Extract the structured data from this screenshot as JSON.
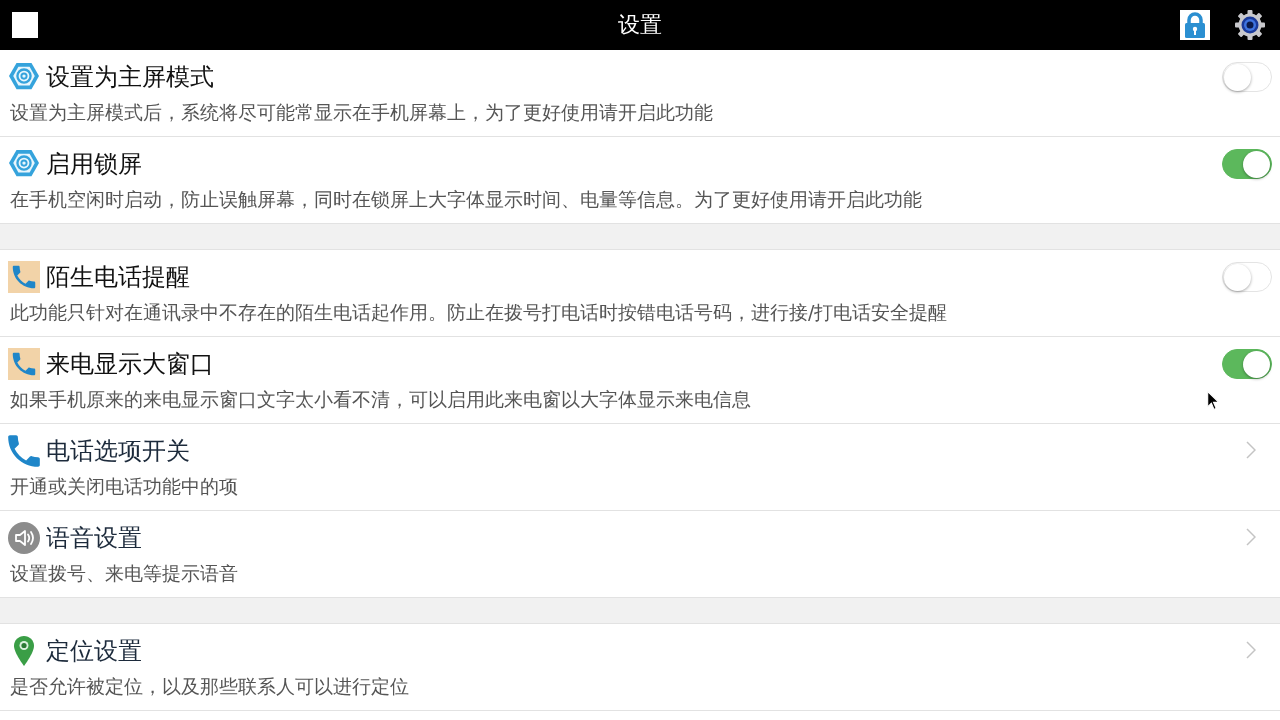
{
  "title_bar": {
    "title": "设置"
  },
  "sections": [
    {
      "items": [
        {
          "kind": "gear",
          "title": "设置为主屏模式",
          "description": "设置为主屏模式后，系统将尽可能常显示在手机屏幕上，为了更好使用请开启此功能",
          "control": {
            "kind": "switch",
            "on": false
          }
        },
        {
          "kind": "gear",
          "title": "启用锁屏",
          "description": "在手机空闲时启动，防止误触屏幕，同时在锁屏上大字体显示时间、电量等信息。为了更好使用请开启此功能",
          "control": {
            "kind": "switch",
            "on": true
          }
        }
      ]
    },
    {
      "items": [
        {
          "kind": "call",
          "title": "陌生电话提醒",
          "description": "此功能只针对在通讯录中不存在的陌生电话起作用。防止在拨号打电话时按错电话号码，进行接/打电话安全提醒",
          "control": {
            "kind": "switch",
            "on": false
          }
        },
        {
          "kind": "call",
          "title": "来电显示大窗口",
          "description": "如果手机原来的来电显示窗口文字太小看不清，可以启用此来电窗以大字体显示来电信息",
          "control": {
            "kind": "switch",
            "on": true
          }
        },
        {
          "kind": "phone",
          "title": "电话选项开关",
          "description": "开通或关闭电话功能中的项",
          "control": {
            "kind": "chevron"
          }
        },
        {
          "kind": "speaker",
          "title": "语音设置",
          "description": "设置拨号、来电等提示语音",
          "control": {
            "kind": "chevron"
          }
        }
      ]
    },
    {
      "items": [
        {
          "kind": "pin",
          "title": "定位设置",
          "description": "是否允许被定位，以及那些联系人可以进行定位",
          "control": {
            "kind": "chevron"
          }
        }
      ]
    }
  ]
}
